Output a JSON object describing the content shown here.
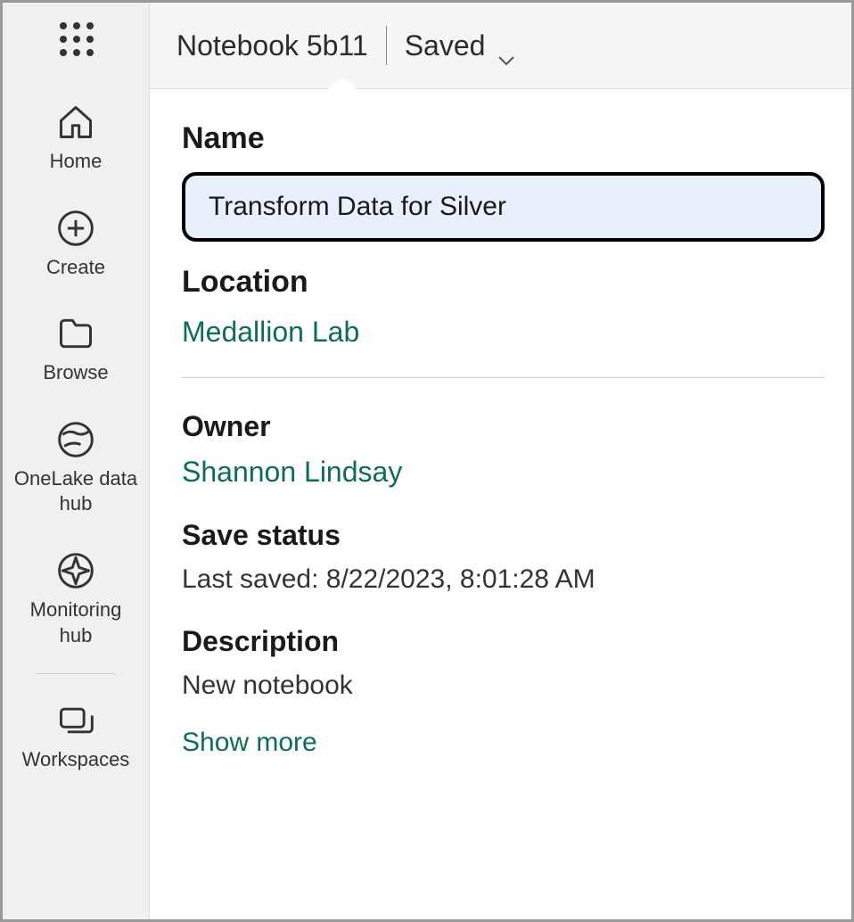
{
  "header": {
    "title": "Notebook 5b11",
    "saved_label": "Saved"
  },
  "sidebar": {
    "items": [
      {
        "label": "Home"
      },
      {
        "label": "Create"
      },
      {
        "label": "Browse"
      },
      {
        "label": "OneLake data hub"
      },
      {
        "label": "Monitoring hub"
      },
      {
        "label": "Workspaces"
      }
    ]
  },
  "panel": {
    "name_label": "Name",
    "name_value": "Transform Data for Silver",
    "location_label": "Location",
    "location_value": "Medallion Lab",
    "owner_label": "Owner",
    "owner_value": "Shannon Lindsay",
    "save_status_label": "Save status",
    "save_status_value": "Last saved: 8/22/2023, 8:01:28 AM",
    "description_label": "Description",
    "description_value": "New notebook",
    "show_more_label": "Show more"
  }
}
